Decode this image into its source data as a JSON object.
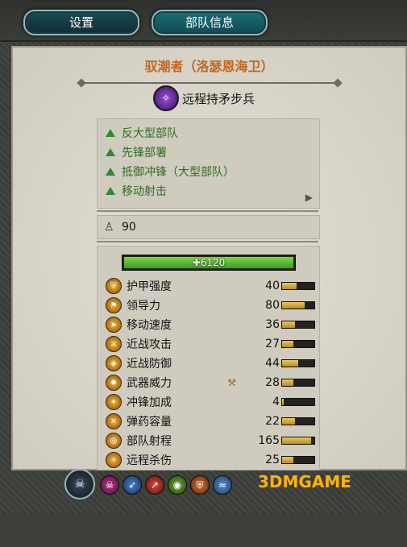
{
  "tabs": [
    {
      "label": "设置"
    },
    {
      "label": "部队信息"
    }
  ],
  "unit": {
    "name": "驭潮者（洛瑟恩海卫）",
    "class_label": "远程持矛步兵"
  },
  "attributes": [
    {
      "label": "反大型部队"
    },
    {
      "label": "先锋部署"
    },
    {
      "label": "抵御冲锋（大型部队）"
    },
    {
      "label": "移动射击"
    }
  ],
  "men_count": "90",
  "health": {
    "text": "6120",
    "fraction": 1.0
  },
  "stats": [
    {
      "label": "护甲强度",
      "value": "40",
      "fraction": 0.45
    },
    {
      "label": "领导力",
      "value": "80",
      "fraction": 0.7
    },
    {
      "label": "移动速度",
      "value": "36",
      "fraction": 0.4
    },
    {
      "label": "近战攻击",
      "value": "27",
      "fraction": 0.35
    },
    {
      "label": "近战防御",
      "value": "44",
      "fraction": 0.5
    },
    {
      "label": "武器威力",
      "value": "28",
      "fraction": 0.35
    },
    {
      "label": "冲锋加成",
      "value": "4",
      "fraction": 0.05
    },
    {
      "label": "弹药容量",
      "value": "22",
      "fraction": 0.4
    },
    {
      "label": "部队射程",
      "value": "165",
      "fraction": 0.9
    },
    {
      "label": "远程杀伤",
      "value": "25",
      "fraction": 0.35
    }
  ],
  "watermark": "3DMGAME"
}
